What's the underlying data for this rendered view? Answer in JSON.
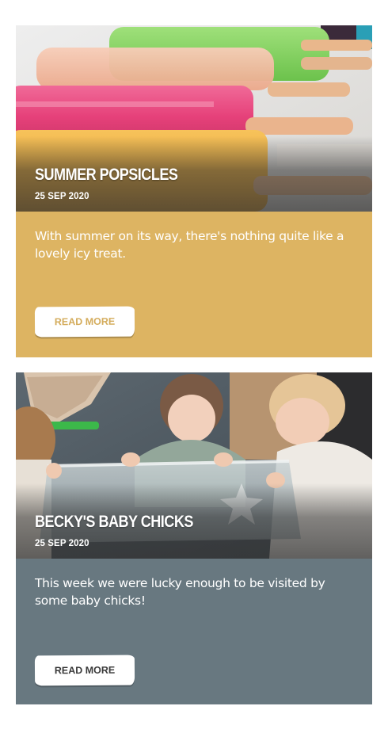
{
  "posts": [
    {
      "title": "SUMMER POPSICLES",
      "date": "25 SEP 2020",
      "excerpt": "With summer on its way, there's nothing quite like a lovely icy treat.",
      "button_label": "READ MORE",
      "panel_color": "#ddb462",
      "image": "popsicles-photo"
    },
    {
      "title": "BECKY'S BABY CHICKS",
      "date": "25 SEP 2020",
      "excerpt": "This week we were lucky enough to be visited by some baby chicks!",
      "button_label": "READ MORE",
      "panel_color": "#687880",
      "image": "children-with-chicks-photo"
    }
  ]
}
